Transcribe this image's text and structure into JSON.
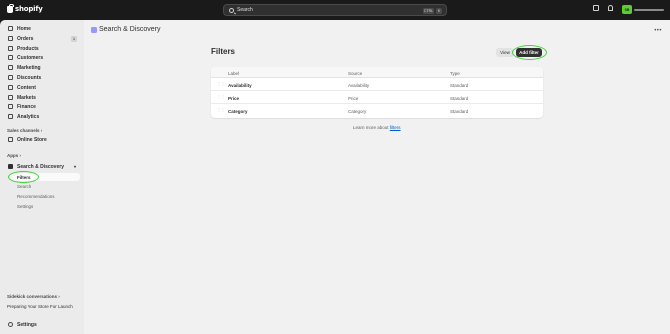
{
  "topbar": {
    "brand": "shopify",
    "search_placeholder": "Search",
    "shortcut_ctrl": "CTRL",
    "shortcut_key": "K",
    "avatar_initials": "SB"
  },
  "sidebar": {
    "items": [
      {
        "label": "Home",
        "icon": "home-icon"
      },
      {
        "label": "Orders",
        "icon": "orders-icon",
        "badge": "1"
      },
      {
        "label": "Products",
        "icon": "products-icon"
      },
      {
        "label": "Customers",
        "icon": "customers-icon"
      },
      {
        "label": "Marketing",
        "icon": "marketing-icon"
      },
      {
        "label": "Discounts",
        "icon": "discounts-icon"
      },
      {
        "label": "Content",
        "icon": "content-icon"
      },
      {
        "label": "Markets",
        "icon": "markets-icon"
      },
      {
        "label": "Finance",
        "icon": "finance-icon"
      },
      {
        "label": "Analytics",
        "icon": "analytics-icon"
      }
    ],
    "sales_channels_label": "Sales channels",
    "online_store_label": "Online Store",
    "apps_label": "Apps",
    "app_name": "Search & Discovery",
    "app_subitems": [
      "Filters",
      "Search",
      "Recommendations",
      "Settings"
    ],
    "sidekick_label": "Sidekick conversations",
    "sidekick_item": "Preparing Your Store For Launch",
    "settings_label": "Settings"
  },
  "main": {
    "app_title": "Search & Discovery",
    "page_title": "Filters",
    "view_button": "View",
    "add_filter_button": "Add filter",
    "table": {
      "headers": [
        "Label",
        "Source",
        "Type"
      ],
      "rows": [
        [
          "Availability",
          "Availability",
          "Standard"
        ],
        [
          "Price",
          "Price",
          "Standard"
        ],
        [
          "Category",
          "Category",
          "Standard"
        ]
      ]
    },
    "learn_more_prefix": "Learn more about",
    "learn_more_link": "filters"
  },
  "colors": {
    "highlight_ring": "#3fd43a",
    "primary_button": "#303030",
    "avatar": "#5bcd2d"
  }
}
